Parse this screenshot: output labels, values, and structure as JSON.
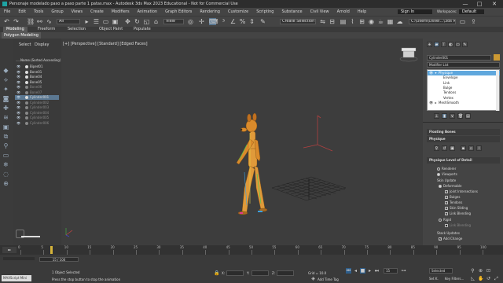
{
  "titlebar": {
    "title": "Personaje modelado paso a paso parte 1 patas.max - Autodesk 3ds Max 2023 Educational - Not for Commercial Use",
    "minimize": "—",
    "maximize": "□",
    "close": "✕"
  },
  "menubar": {
    "items": [
      "File",
      "Edit",
      "Tools",
      "Group",
      "Views",
      "Create",
      "Modifiers",
      "Animation",
      "Graph Editors",
      "Rendering",
      "Customize",
      "Scripting",
      "Substance",
      "Civil View",
      "Arnold",
      "Help"
    ],
    "sign_in": "Sign In",
    "workspaces_label": "Workspaces:",
    "workspace_value": "Default"
  },
  "toolbar": {
    "filter_value": "All",
    "view_value": "View",
    "selection_set_placeholder": "Create Selection Set",
    "path_value": "C:\\Users\\Osvel...\\3ds Max 2023"
  },
  "ribbon": {
    "tabs": [
      "Modeling",
      "Freeform",
      "Selection",
      "Object Paint",
      "Populate"
    ],
    "active_tab": "Modeling",
    "subtab": "Polygon Modeling"
  },
  "scene_explorer": {
    "tabs": [
      "Select",
      "Display"
    ],
    "header": "Name (Sorted Ascending)",
    "items": [
      {
        "name": "Biped01",
        "dim": false,
        "selected": false
      },
      {
        "name": "Bone01",
        "dim": false,
        "selected": false
      },
      {
        "name": "Bone04",
        "dim": false,
        "selected": false
      },
      {
        "name": "Bone05",
        "dim": false,
        "selected": false
      },
      {
        "name": "Bone06",
        "dim": true,
        "selected": false
      },
      {
        "name": "Bone07",
        "dim": true,
        "selected": false
      },
      {
        "name": "Cylinder001",
        "dim": false,
        "selected": true
      },
      {
        "name": "Cylinder002",
        "dim": true,
        "selected": false
      },
      {
        "name": "Cylinder003",
        "dim": true,
        "selected": false
      },
      {
        "name": "Cylinder004",
        "dim": true,
        "selected": false
      },
      {
        "name": "Cylinder005",
        "dim": true,
        "selected": false
      },
      {
        "name": "Cylinder006",
        "dim": true,
        "selected": false
      }
    ]
  },
  "viewport": {
    "label": "[+] [Perspective] [Standard] [Edged Faces]"
  },
  "command_panel": {
    "object_name": "Cylinder001",
    "modifier_list_label": "Modifier List",
    "stack": [
      {
        "name": "Physique",
        "level": 0,
        "selected": true
      },
      {
        "name": "Envelope",
        "level": 1,
        "selected": false
      },
      {
        "name": "Link",
        "level": 1,
        "selected": false
      },
      {
        "name": "Bulge",
        "level": 1,
        "selected": false
      },
      {
        "name": "Tendons",
        "level": 1,
        "selected": false
      },
      {
        "name": "Vertex",
        "level": 1,
        "selected": false
      },
      {
        "name": "MeshSmooth",
        "level": 0,
        "selected": false
      }
    ],
    "sections": {
      "floating_bones": "Floating Bones",
      "physique": "Physique",
      "level_of_detail": "Physique Level of Detail"
    },
    "render_options": [
      "Renderer",
      "Viewports"
    ],
    "skin_update_label": "Skin Update",
    "deformable_label": "Deformable",
    "deformable_checks": [
      "Joint Intersections",
      "Bulges",
      "Tendons",
      "Skin Sliding",
      "Link Blending"
    ],
    "rigid_label": "Rigid",
    "rigid_sub": "Link Blending",
    "stack_updates_label": "Stack Updates",
    "add_change_label": "Add Change"
  },
  "timeline": {
    "frame_indicator": "15 / 100",
    "ticks": [
      "0",
      "5",
      "10",
      "15",
      "20",
      "25",
      "30",
      "35",
      "40",
      "45",
      "50",
      "55",
      "60",
      "65",
      "70",
      "75",
      "80",
      "85",
      "90",
      "95",
      "100"
    ]
  },
  "statusbar": {
    "maxscript": "MAXScript Mini",
    "selection": "1 Object Selected",
    "prompt": "Press the stop button to stop the animation",
    "x_label": "X:",
    "y_label": "Y:",
    "z_label": "Z:",
    "grid": "Grid = 10.0",
    "add_time_tag": "Add Time Tag",
    "autokey_select": "Selected",
    "set_key": "Set K.",
    "key_filters": "Key Filters...",
    "frame_field": "15"
  }
}
